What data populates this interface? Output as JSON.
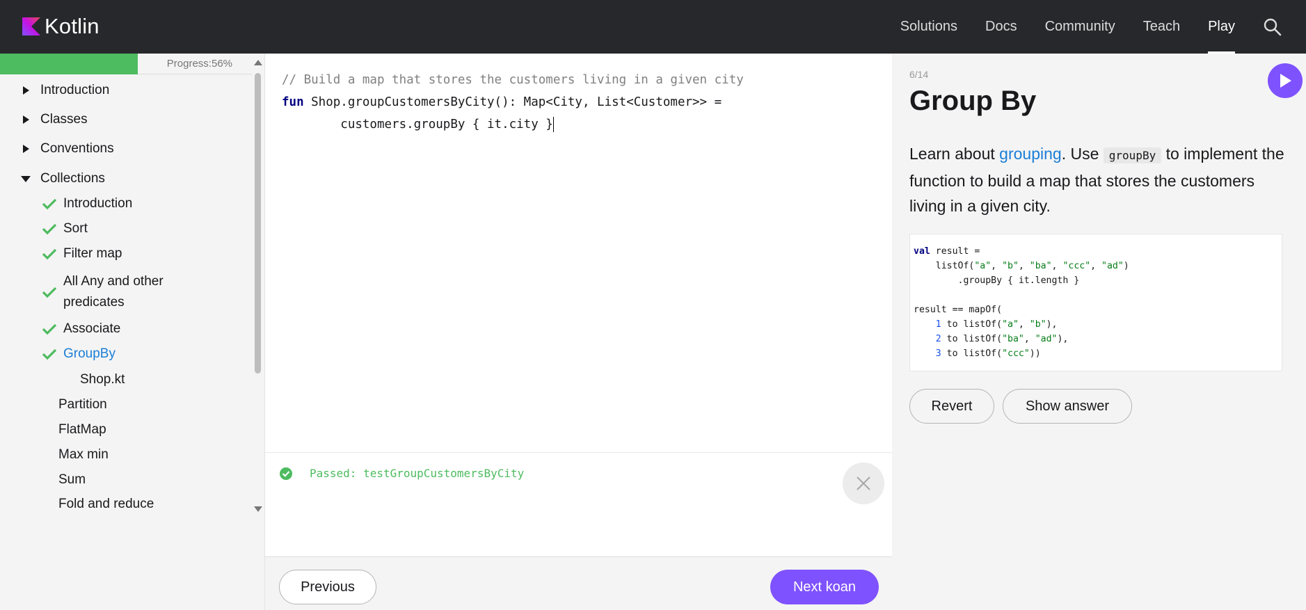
{
  "header": {
    "logo_text": "Kotlin",
    "nav": [
      "Solutions",
      "Docs",
      "Community",
      "Teach",
      "Play"
    ],
    "active_nav": "Play"
  },
  "sidebar": {
    "progress_label": "Progress:56%",
    "progress_fraction": 0.56,
    "items": [
      {
        "label": "Introduction",
        "state": "collapsed"
      },
      {
        "label": "Classes",
        "state": "collapsed"
      },
      {
        "label": "Conventions",
        "state": "collapsed"
      },
      {
        "label": "Collections",
        "state": "expanded"
      },
      {
        "label": "Introduction",
        "state": "done"
      },
      {
        "label": "Sort",
        "state": "done"
      },
      {
        "label": "Filter map",
        "state": "done"
      },
      {
        "label": "All Any and other",
        "label2": "predicates",
        "state": "done"
      },
      {
        "label": "Associate",
        "state": "done"
      },
      {
        "label": "GroupBy",
        "state": "current"
      },
      {
        "label": "Shop.kt",
        "state": "file"
      },
      {
        "label": "Partition",
        "state": "todo"
      },
      {
        "label": "FlatMap",
        "state": "todo"
      },
      {
        "label": "Max min",
        "state": "todo"
      },
      {
        "label": "Sum",
        "state": "todo"
      },
      {
        "label": "Fold and reduce",
        "state": "todo"
      }
    ]
  },
  "editor": {
    "line1_comment": "// Build a map that stores the customers living in a given city",
    "line2_kw": "fun",
    "line2_rest": " Shop.groupCustomersByCity(): Map<City, List<Customer>> =",
    "line3": "        customers.groupBy { it.city }"
  },
  "console": {
    "result": "Passed: testGroupCustomersByCity"
  },
  "footer": {
    "previous_label": "Previous",
    "next_label": "Next koan"
  },
  "panel": {
    "counter": "6/14",
    "title": "Group By",
    "desc_before": "Learn about ",
    "desc_link": "grouping",
    "desc_mid": ". Use ",
    "desc_code": "groupBy",
    "desc_after": " to implement the function to build a map that stores the customers living in a given city.",
    "revert_label": "Revert",
    "answer_label": "Show answer"
  },
  "colors": {
    "accent": "#7f52ff",
    "success": "#4dbb5f",
    "link": "#1b7ed7",
    "topbar": "#27282c"
  }
}
